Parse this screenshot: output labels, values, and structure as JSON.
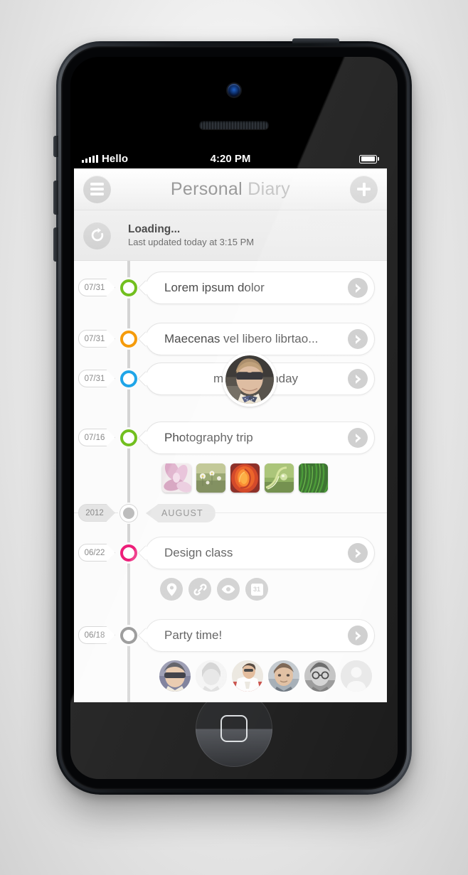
{
  "status_bar": {
    "carrier": "Hello",
    "time": "4:20 PM",
    "signal_bars": 5,
    "battery_full": true
  },
  "navbar": {
    "menu_icon": "hamburger-icon",
    "title_primary": "Personal",
    "title_secondary": "Diary",
    "add_icon": "plus-icon"
  },
  "loading": {
    "refresh_icon": "refresh-icon",
    "title": "Loading...",
    "subtitle": "Last updated today at 3:15 PM"
  },
  "timeline": {
    "entries": [
      {
        "date": "07/31",
        "title": "Lorem ipsum dolor",
        "marker_color": "#72bf1f",
        "type": "entry"
      },
      {
        "date": "07/31",
        "title": "Maecenas vel libero librtao...",
        "marker_color": "#f59b0b",
        "type": "entry"
      },
      {
        "date": "07/31",
        "title": "musHo birthday",
        "marker_color": "#1fa5e8",
        "type": "entry-avatar",
        "avatar": "avatar-musho"
      },
      {
        "date": "07/16",
        "title": "Photography trip",
        "marker_color": "#72bf1f",
        "type": "entry-photos",
        "photos": [
          "photo-pink-flower",
          "photo-daisies",
          "photo-red-rose",
          "photo-green-leaf",
          "photo-grass"
        ]
      },
      {
        "date": "2012",
        "title": "AUGUST",
        "marker_color": "#bdbdbd",
        "type": "divider"
      },
      {
        "date": "06/22",
        "title": "Design class",
        "marker_color": "#ed1e79",
        "type": "entry-actions",
        "actions": [
          "location-pin-icon",
          "link-icon",
          "eye-icon",
          "calendar-icon"
        ],
        "calendar_day": "31"
      },
      {
        "date": "06/18",
        "title": "Party time!",
        "marker_color": "#8c8c8c",
        "type": "entry-faces",
        "faces": [
          "face-sunglasses",
          "face-light",
          "face-white-shirt",
          "face-man",
          "face-glasses",
          "face-placeholder"
        ]
      }
    ]
  },
  "colors": {
    "green": "#72bf1f",
    "orange": "#f59b0b",
    "blue": "#1fa5e8",
    "magenta": "#ed1e79",
    "gray": "#8c8c8c",
    "timeline_line": "#d4d4d4",
    "card_bg": "#ffffff",
    "screen_bg": "#fbfbfb"
  }
}
